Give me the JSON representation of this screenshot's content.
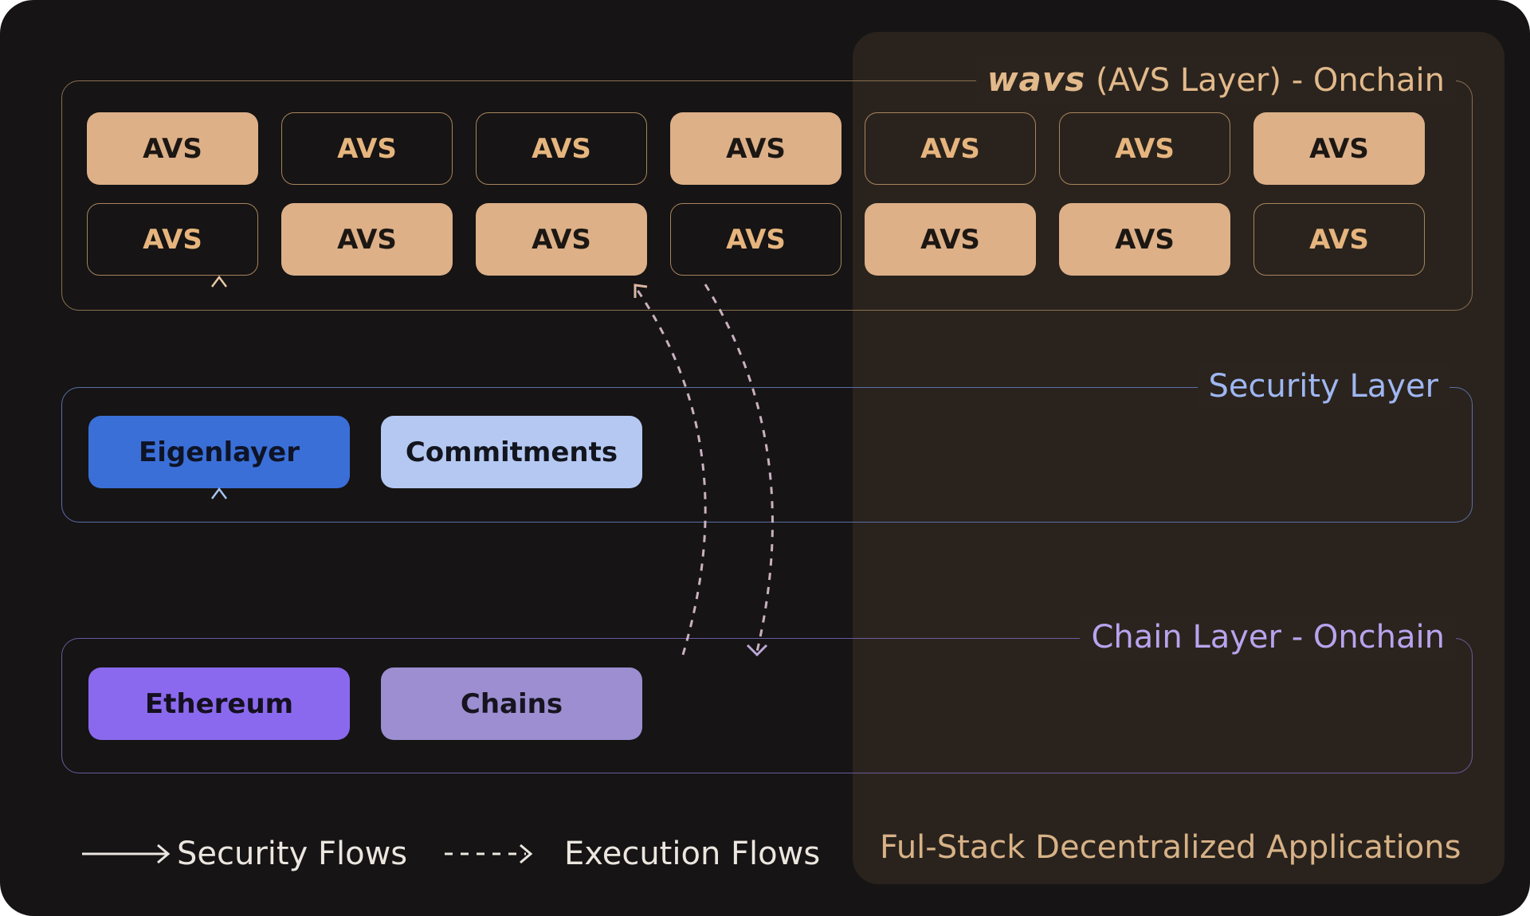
{
  "avs_layer": {
    "logo": "wavs",
    "title": "(AVS Layer) - Onchain",
    "row1": [
      {
        "label": "AVS",
        "style": "filled"
      },
      {
        "label": "AVS",
        "style": "outline"
      },
      {
        "label": "AVS",
        "style": "outline"
      },
      {
        "label": "AVS",
        "style": "filled"
      },
      {
        "label": "AVS",
        "style": "outline"
      },
      {
        "label": "AVS",
        "style": "outline"
      },
      {
        "label": "AVS",
        "style": "filled"
      }
    ],
    "row2": [
      {
        "label": "AVS",
        "style": "outline"
      },
      {
        "label": "AVS",
        "style": "filled"
      },
      {
        "label": "AVS",
        "style": "filled"
      },
      {
        "label": "AVS",
        "style": "outline"
      },
      {
        "label": "AVS",
        "style": "filled"
      },
      {
        "label": "AVS",
        "style": "filled"
      },
      {
        "label": "AVS",
        "style": "outline"
      }
    ]
  },
  "security_layer": {
    "title": "Security Layer",
    "nodes": [
      "Eigenlayer",
      "Commitments"
    ]
  },
  "chain_layer": {
    "title": "Chain Layer - Onchain",
    "nodes": [
      "Ethereum",
      "Chains"
    ]
  },
  "legend": {
    "security": "Security Flows",
    "execution": "Execution Flows"
  },
  "footer": "Ful-Stack Decentralized Applications",
  "colors": {
    "background": "#161414",
    "right_panel": "#2b241e",
    "avs_accent": "#e2b98b",
    "security_accent": "#9fb7f2",
    "chain_accent": "#b7a4ee"
  }
}
